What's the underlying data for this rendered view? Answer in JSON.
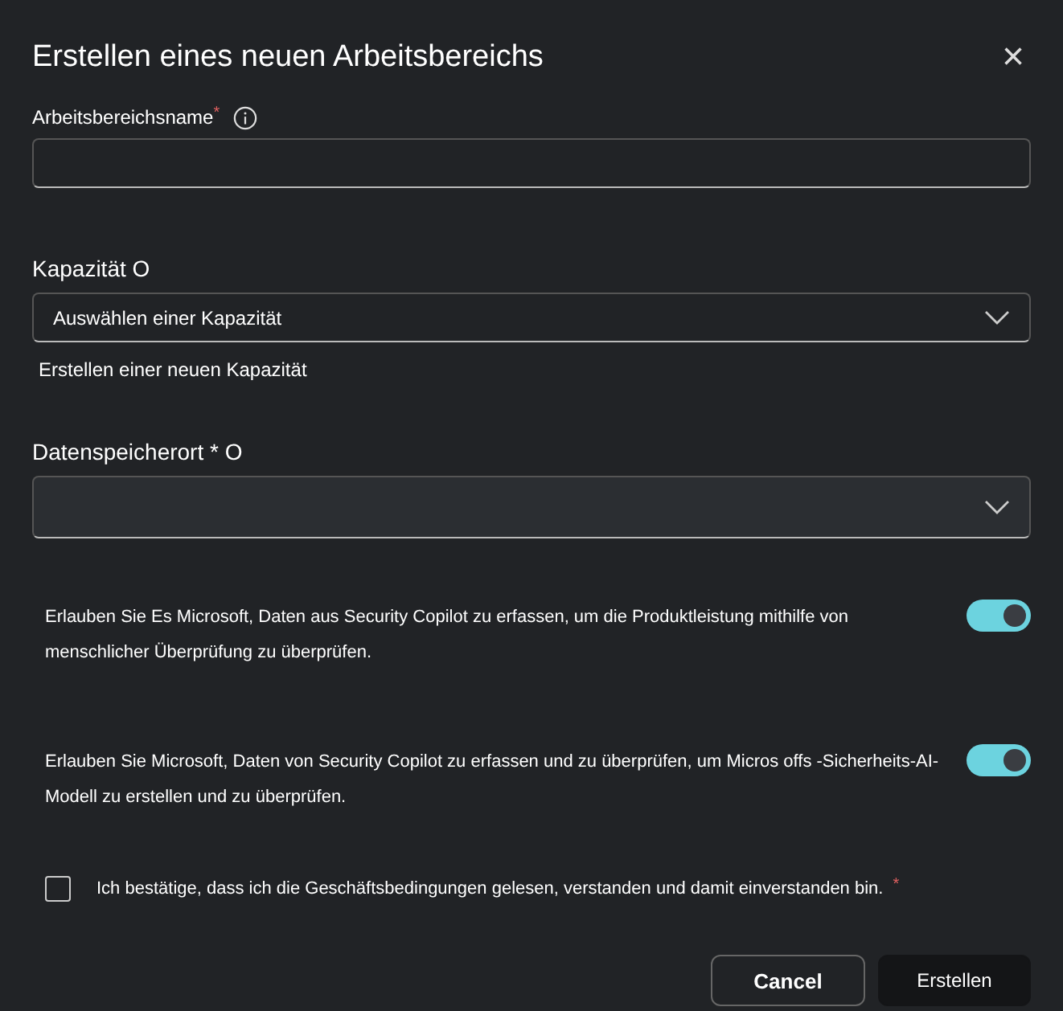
{
  "dialog": {
    "title": "Erstellen eines neuen Arbeitsbereichs",
    "close_label": "×"
  },
  "name_field": {
    "label": "Arbeitsbereichsname",
    "required_mark": "*"
  },
  "capacity": {
    "label": "Kapazität O",
    "value": "Auswählen einer Kapazität",
    "link": "Erstellen einer neuen Kapazität"
  },
  "storage": {
    "label": "Datenspeicherort * O"
  },
  "toggles": [
    {
      "text": "Erlauben Sie Es Microsoft, Daten aus Security Copilot zu erfassen, um die Produktleistung mithilfe von menschlicher Überprüfung zu überprüfen.",
      "on": true
    },
    {
      "text": "Erlauben Sie Microsoft, Daten von Security Copilot zu erfassen und zu überprüfen, um Micros offs -Sicherheits-AI-Modell zu erstellen und zu überprüfen.",
      "on": true
    }
  ],
  "consent": {
    "text": "Ich bestätige, dass ich die Geschäftsbedingungen gelesen, verstanden und damit einverstanden bin.",
    "required_mark": "*",
    "checked": false
  },
  "buttons": [
    {
      "label": "Cancel",
      "kind": "secondary"
    },
    {
      "label": "Erstellen",
      "kind": "primary"
    }
  ]
}
